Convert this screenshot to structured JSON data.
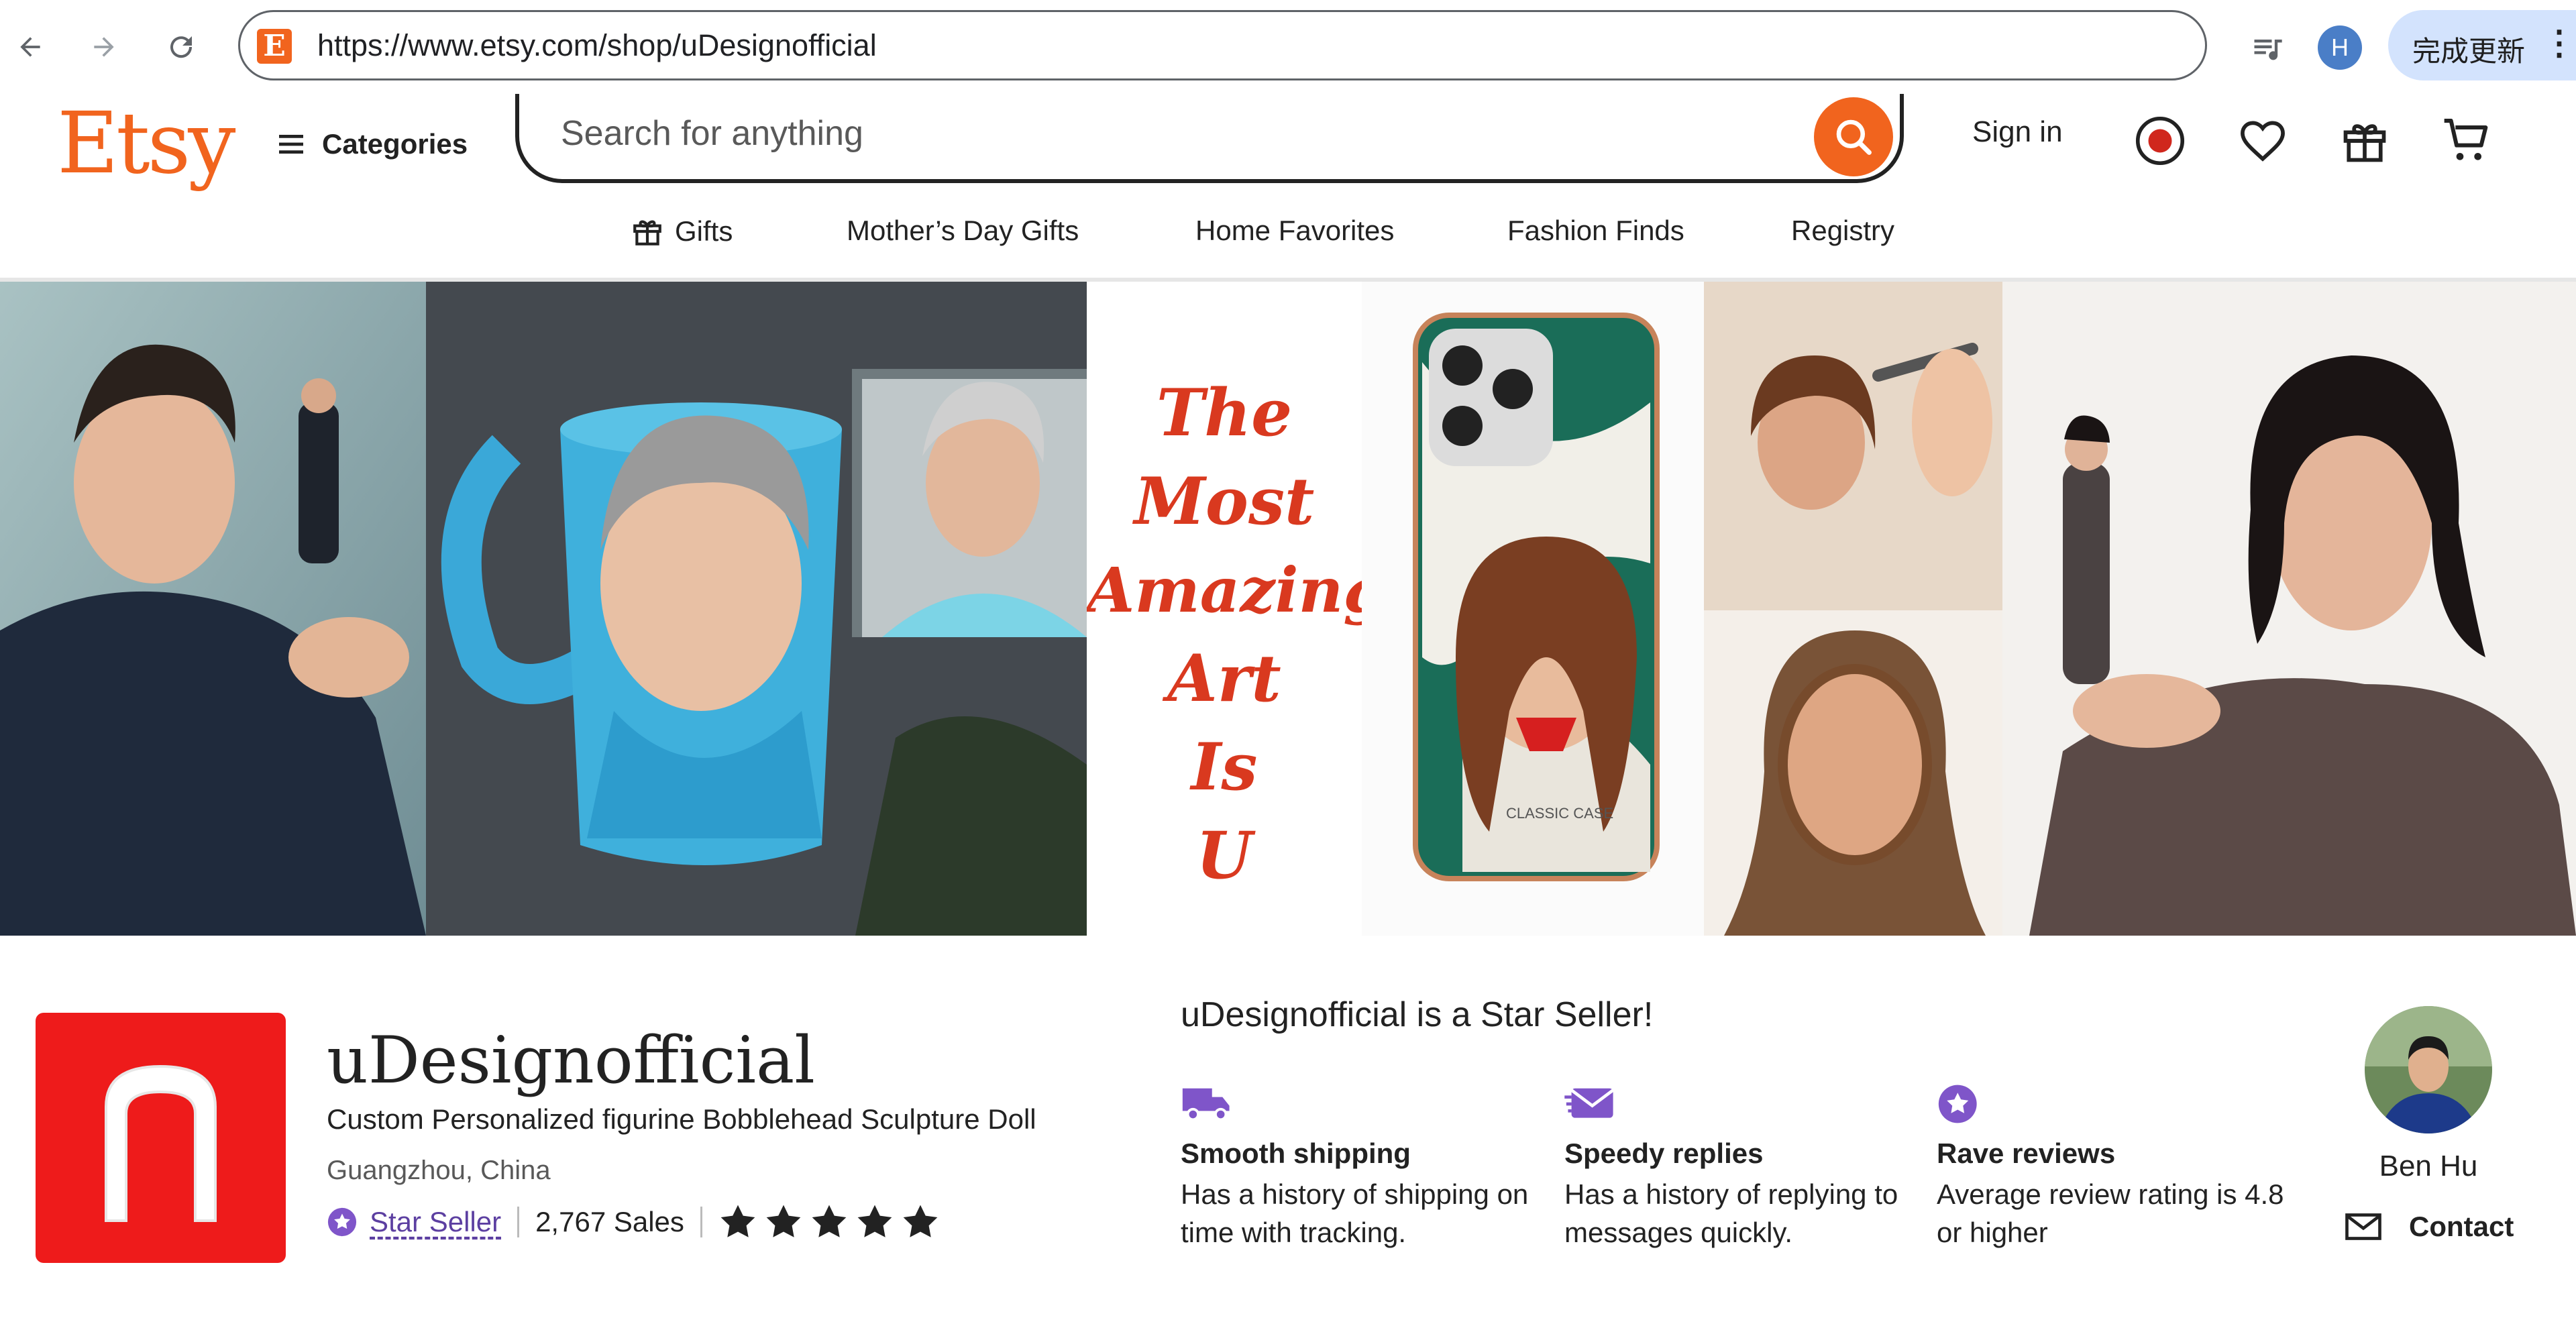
{
  "browser": {
    "url": "https://www.etsy.com/shop/uDesignofficial",
    "favicon_letter": "E",
    "profile_initial": "H",
    "update_label": "完成更新",
    "menu_glyph": "⋮"
  },
  "header": {
    "logo": "Etsy",
    "categories_label": "Categories",
    "search_placeholder": "Search for anything",
    "sign_in": "Sign in",
    "nav": [
      "Gifts",
      "Mother’s Day Gifts",
      "Home Favorites",
      "Fashion Finds",
      "Registry"
    ]
  },
  "banner": {
    "text_lines": [
      "The",
      "Most",
      "Amazing",
      "Art",
      "Is",
      "U"
    ],
    "phone_case_label": "CLASSIC CASE"
  },
  "shop": {
    "name": "uDesignofficial",
    "tagline": "Custom Personalized figurine Bobblehead Sculpture Doll",
    "location": "Guangzhou, China",
    "star_seller_label": "Star Seller",
    "sales": "2,767 Sales",
    "rating_stars": 5
  },
  "star_seller": {
    "heading": "uDesignofficial is a Star Seller!",
    "features": [
      {
        "icon": "truck-icon",
        "title": "Smooth shipping",
        "desc": "Has a history of shipping on time with tracking."
      },
      {
        "icon": "envelope-icon",
        "title": "Speedy replies",
        "desc": "Has a history of replying to messages quickly."
      },
      {
        "icon": "star-badge-icon",
        "title": "Rave reviews",
        "desc": "Average review rating is 4.8 or higher"
      }
    ]
  },
  "owner": {
    "name": "Ben Hu",
    "contact_label": "Contact"
  },
  "colors": {
    "etsy_orange": "#f1641e",
    "star_seller_purple": "#7f55c9",
    "shop_logo_red": "#ee1b1b",
    "banner_text_red": "#d9391f"
  }
}
